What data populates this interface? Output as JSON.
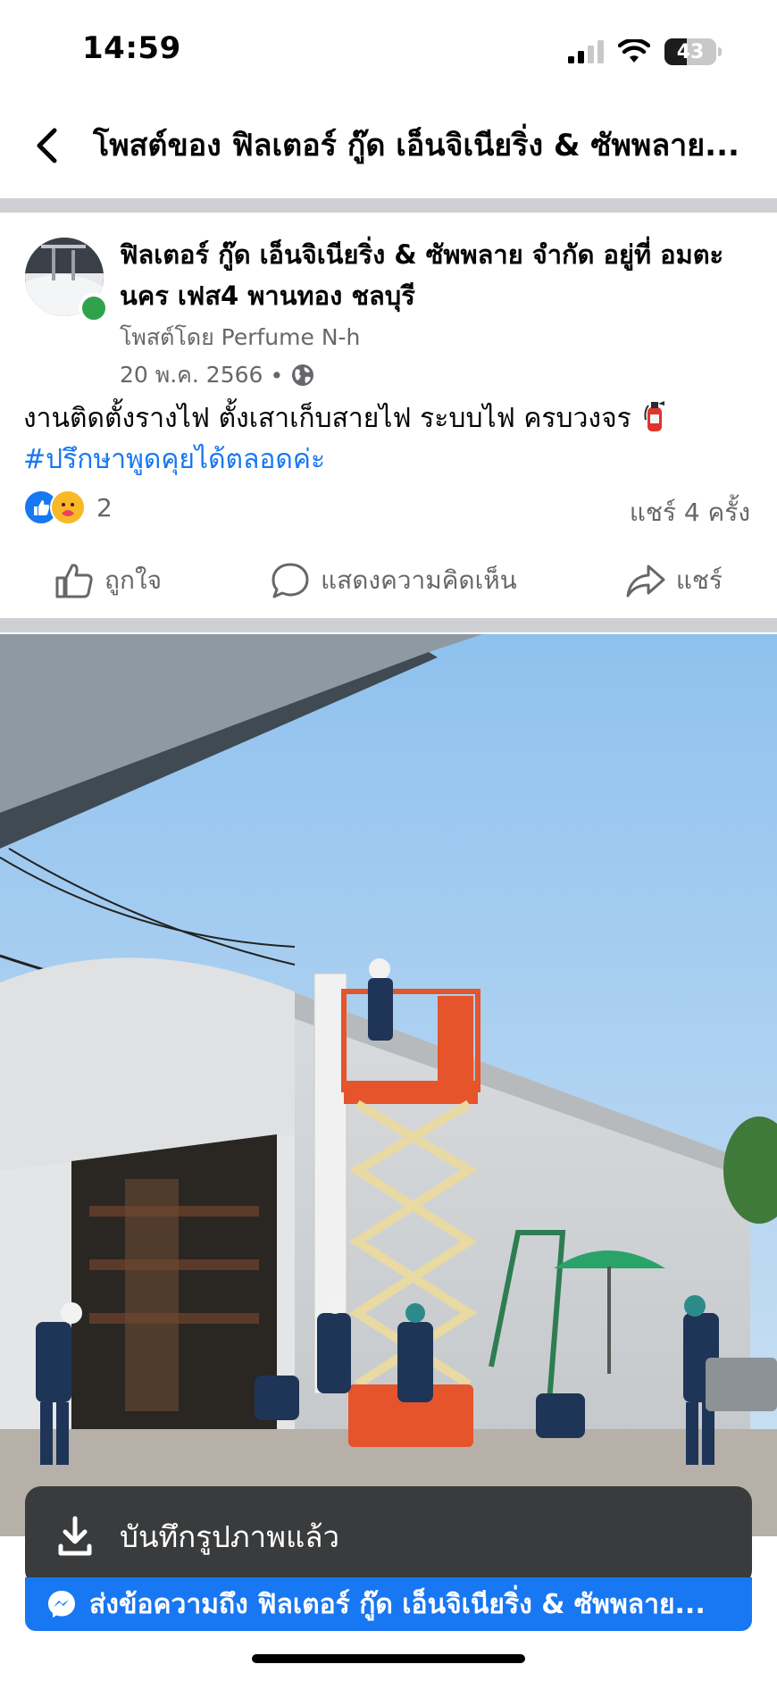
{
  "status_bar": {
    "time": "14:59",
    "battery": "43"
  },
  "header": {
    "title": "โพสต์ของ ฟิลเตอร์ กู๊ด เอ็นจิเนียริ่ง & ซัพพลาย..."
  },
  "post": {
    "page_name": "ฟิลเตอร์ กู๊ด เอ็นจิเนียริ่ง & ซัพพลาย จำกัด อยู่ที่ อมตะนคร เฟส4 พานทอง ชลบุรี",
    "posted_by": "โพสต์โดย Perfume N-h",
    "date": "20 พ.ค. 2566",
    "meta_separator": "•",
    "text": "งานติดตั้งรางไฟ ตั้งเสาเก็บสายไฟ ระบบไฟ ครบวงจร",
    "hashtag": "#ปรึกษาพูดคุยได้ตลอดค่ะ",
    "reaction_count": "2",
    "shares": "แชร์ 4 ครั้ง"
  },
  "actions": {
    "like": "ถูกใจ",
    "comment": "แสดงความคิดเห็น",
    "share": "แชร์"
  },
  "toast": {
    "text": "บันทึกรูปภาพแล้ว"
  },
  "messenger_bar": {
    "text": "ส่งข้อความถึง ฟิลเตอร์ กู๊ด เอ็นจิเนียริ่ง & ซัพพลาย..."
  },
  "colors": {
    "brand_blue": "#1877f2",
    "online_green": "#31a24c",
    "muted_text": "#65676b",
    "toast_bg": "#3a3b3c"
  },
  "icons": [
    "signal-icon",
    "wifi-icon",
    "battery-icon",
    "back-chevron-icon",
    "globe-icon",
    "fire-extinguisher-icon",
    "like-reaction-icon",
    "care-reaction-icon",
    "thumbs-up-icon",
    "comment-icon",
    "share-icon",
    "download-icon",
    "messenger-icon"
  ]
}
